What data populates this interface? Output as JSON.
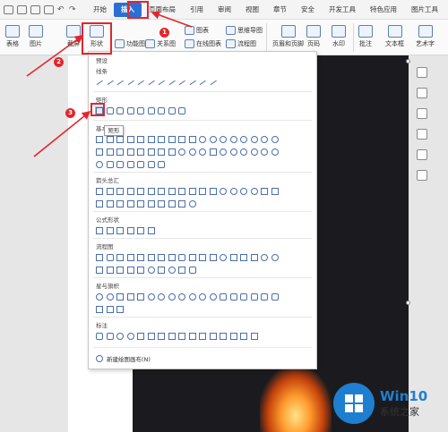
{
  "tabs": [
    "开始",
    "插入",
    "页面布局",
    "引用",
    "审阅",
    "视图",
    "章节",
    "安全",
    "开发工具",
    "特色应用",
    "图片工具"
  ],
  "active_tab": "插入",
  "ribbon": {
    "table": "表格",
    "picture": "图片",
    "screenshot": "截屏",
    "shape": "形状",
    "funcmap": "功能图",
    "relation": "关系图",
    "chart": "图表",
    "online_chart": "在线图表",
    "mindmap": "思维导图",
    "flowchart": "流程图",
    "header_footer": "页眉和页脚",
    "page_no": "页码",
    "watermark": "水印",
    "comment": "批注",
    "textbox": "文本框",
    "wordart": "艺术字"
  },
  "shape_menu": {
    "recent": "预设",
    "lines": "线条",
    "rect": "矩形",
    "basic": "基本形状",
    "arrows": "箭头总汇",
    "formula": "公式形状",
    "flowchart": "流程图",
    "stars": "星与旗帜",
    "callouts": "标注",
    "new_canvas": "新建绘图画布(N)",
    "tooltip": "矩形"
  },
  "annotations": {
    "n1": "1",
    "n2": "2",
    "n3": "3"
  },
  "watermark": {
    "brand": "Win10",
    "site": "系统之家"
  },
  "colors": {
    "accent": "#2b6fd6",
    "annotation_red": "#e3262c",
    "logo_blue": "#1e7fd0"
  }
}
